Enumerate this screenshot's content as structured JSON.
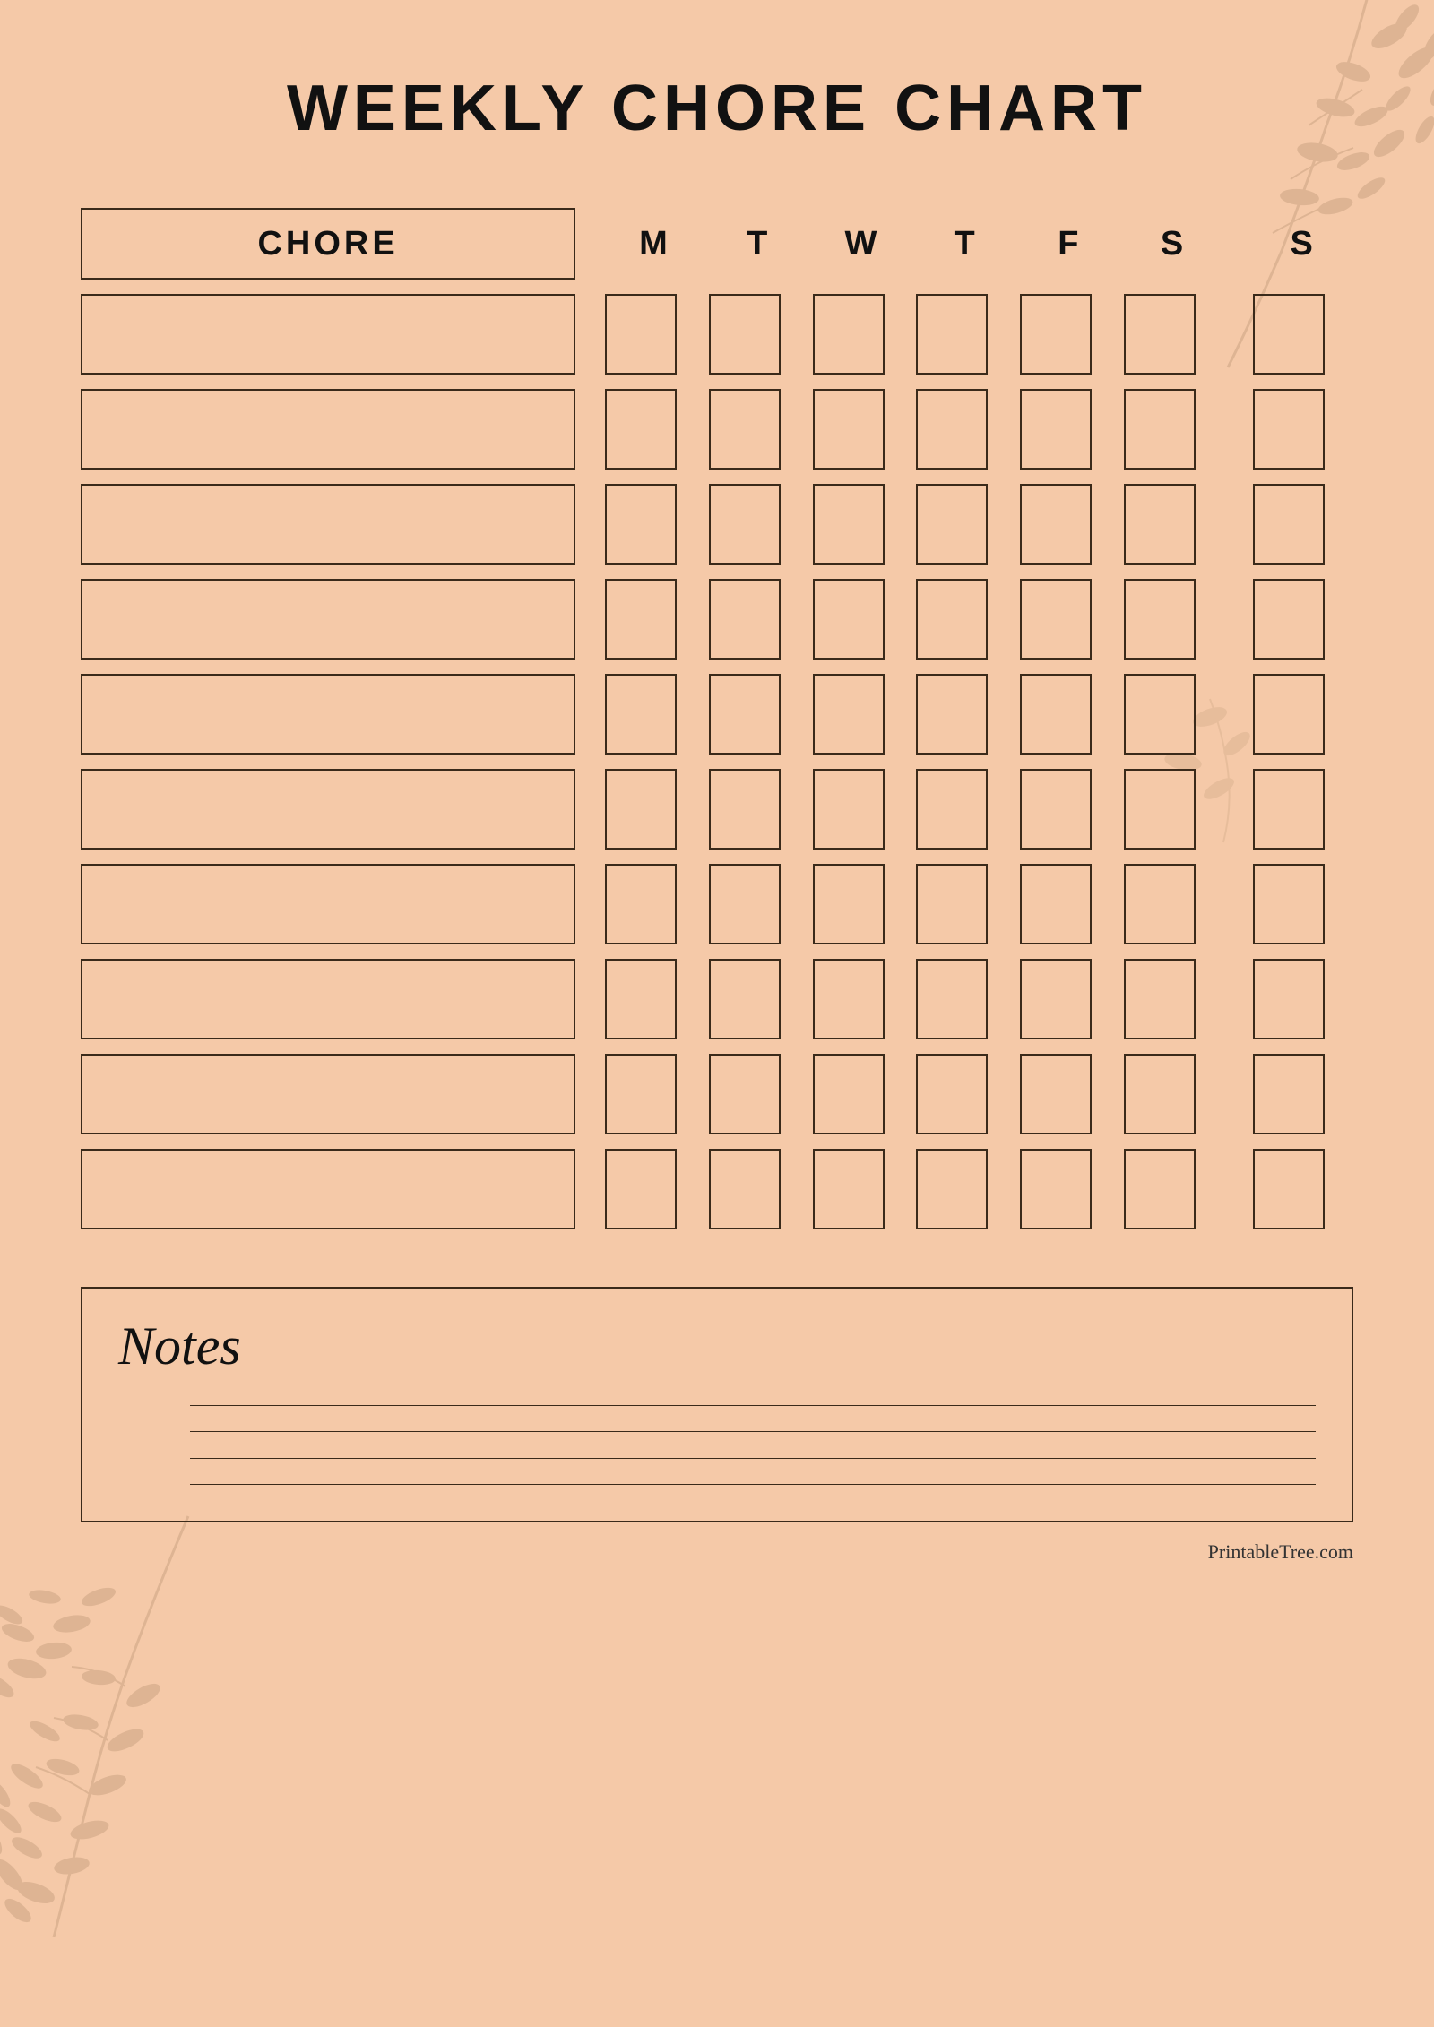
{
  "title": "WEEKLY CHORE CHART",
  "header": {
    "chore_label": "CHORE",
    "days": [
      "M",
      "T",
      "W",
      "T",
      "F",
      "S",
      "S"
    ]
  },
  "rows": [
    {
      "id": 1
    },
    {
      "id": 2
    },
    {
      "id": 3
    },
    {
      "id": 4
    },
    {
      "id": 5
    },
    {
      "id": 6
    },
    {
      "id": 7
    },
    {
      "id": 8
    },
    {
      "id": 9
    },
    {
      "id": 10
    }
  ],
  "notes": {
    "title": "Notes",
    "lines": [
      1,
      2,
      3,
      4
    ]
  },
  "footer": {
    "text": "PrintableTree.com"
  },
  "colors": {
    "background": "#f5c9a8",
    "border": "#3a2a1a",
    "text": "#111111"
  }
}
